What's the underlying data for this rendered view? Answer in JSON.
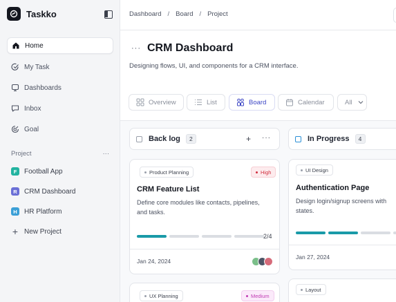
{
  "app": {
    "name": "Taskko"
  },
  "sidebar": {
    "nav": [
      {
        "label": "Home",
        "icon": "home-icon",
        "active": true
      },
      {
        "label": "My Task",
        "icon": "check-circle-icon"
      },
      {
        "label": "Dashboards",
        "icon": "monitor-icon"
      },
      {
        "label": "Inbox",
        "icon": "chat-icon"
      },
      {
        "label": "Goal",
        "icon": "target-icon"
      }
    ],
    "project_heading": "Project",
    "project_more": "···",
    "projects": [
      {
        "badge": "F",
        "label": "Football App",
        "color": "#22b3a0"
      },
      {
        "badge": "R",
        "label": "CRM Dashboard",
        "color": "#6a6fd6"
      },
      {
        "badge": "H",
        "label": "HR Platform",
        "color": "#3b9fd6"
      }
    ],
    "new_project": "New Project"
  },
  "breadcrumb": [
    "Dashboard",
    "Board",
    "Project"
  ],
  "header": {
    "more": "···",
    "title": "CRM Dashboard",
    "description": "Designing flows, UI, and components for a CRM interface."
  },
  "views": [
    {
      "label": "Overview",
      "icon": "grid-icon"
    },
    {
      "label": "List",
      "icon": "list-icon"
    },
    {
      "label": "Board",
      "icon": "board-icon",
      "active": true
    },
    {
      "label": "Calendar",
      "icon": "calendar-icon"
    }
  ],
  "filter": {
    "label": "All"
  },
  "columns": [
    {
      "title": "Back log",
      "count": "2",
      "add": "+",
      "more": "···",
      "cards": [
        {
          "tag": "Product Planning",
          "priority": "High",
          "title": "CRM Feature List",
          "desc_line1": "Define core modules like contacts, pipelines,",
          "desc_line2": "and tasks.",
          "progress_done": 1,
          "progress_total": 4,
          "progress_label": "2/4",
          "date": "Jan 24, 2024"
        },
        {
          "tag": "UX Planning",
          "priority": "Medium"
        }
      ]
    },
    {
      "title": "In Progress",
      "count": "4",
      "cards": [
        {
          "tag": "UI Design",
          "title": "Authentication Page",
          "desc_line1": "Design login/signup screens with",
          "desc_line2": "states.",
          "progress_done": 2,
          "progress_total": 4,
          "date": "Jan 27, 2024"
        },
        {
          "tag": "Layout"
        }
      ]
    }
  ],
  "colors": {
    "accent": "#3b45c4",
    "progress": "#1a9aa8",
    "high": "#d12f3f",
    "medium": "#c03bb3"
  }
}
